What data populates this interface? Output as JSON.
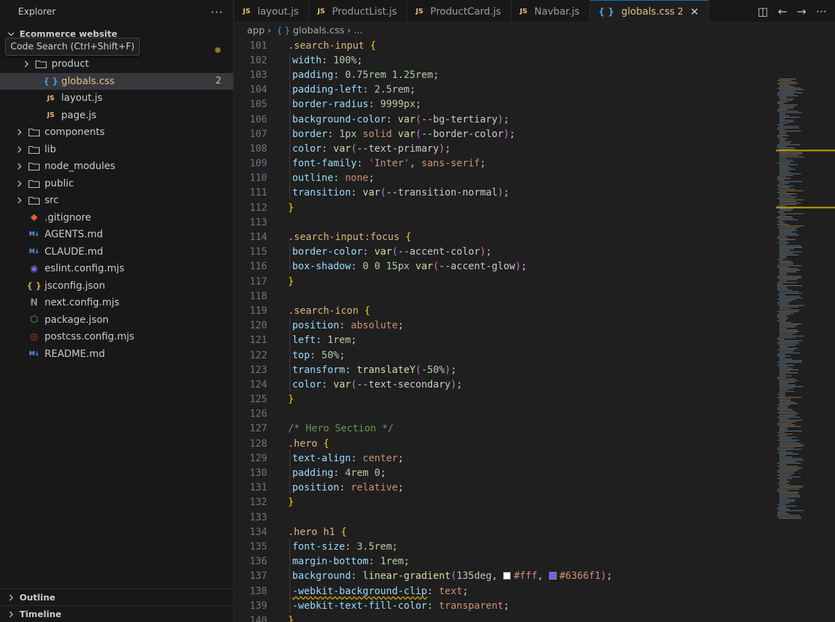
{
  "sidebar": {
    "title": "Explorer",
    "more": "···",
    "root": "Ecommerce website",
    "tooltip": "Code Search (Ctrl+Shift+F)",
    "items": [
      {
        "label": "product",
        "kind": "folder",
        "badge": ""
      },
      {
        "label": "globals.css",
        "kind": "css",
        "badge": "2"
      },
      {
        "label": "layout.js",
        "kind": "js",
        "badge": ""
      },
      {
        "label": "page.js",
        "kind": "js",
        "badge": ""
      },
      {
        "label": "components",
        "kind": "folder",
        "badge": ""
      },
      {
        "label": "lib",
        "kind": "folder",
        "badge": ""
      },
      {
        "label": "node_modules",
        "kind": "folder",
        "badge": ""
      },
      {
        "label": "public",
        "kind": "folder",
        "badge": ""
      },
      {
        "label": "src",
        "kind": "folder",
        "badge": ""
      },
      {
        "label": ".gitignore",
        "kind": "git",
        "badge": ""
      },
      {
        "label": "AGENTS.md",
        "kind": "md",
        "badge": ""
      },
      {
        "label": "CLAUDE.md",
        "kind": "md",
        "badge": ""
      },
      {
        "label": "eslint.config.mjs",
        "kind": "eslint",
        "badge": ""
      },
      {
        "label": "jsconfig.json",
        "kind": "json",
        "badge": ""
      },
      {
        "label": "next.config.mjs",
        "kind": "next",
        "badge": ""
      },
      {
        "label": "package.json",
        "kind": "npm",
        "badge": ""
      },
      {
        "label": "postcss.config.mjs",
        "kind": "postcss",
        "badge": ""
      },
      {
        "label": "README.md",
        "kind": "md",
        "badge": ""
      }
    ],
    "outline": "Outline",
    "timeline": "Timeline"
  },
  "tabs": [
    {
      "label": "layout.js",
      "icon": "JS"
    },
    {
      "label": "ProductList.js",
      "icon": "JS"
    },
    {
      "label": "ProductCard.js",
      "icon": "JS"
    },
    {
      "label": "Navbar.js",
      "icon": "JS"
    },
    {
      "label": "globals.css",
      "icon": "{ }",
      "badge": "2",
      "close": "✕",
      "active": true
    }
  ],
  "breadcrumb": {
    "folder": "app",
    "icon": "{ }",
    "file": "globals.css",
    "more": "..."
  },
  "code": [
    {
      "n": "101",
      "t": [
        [
          "sel",
          ".search-input "
        ],
        [
          "brace",
          "{"
        ]
      ]
    },
    {
      "n": "102",
      "t": [
        [
          "prop",
          "width"
        ],
        [
          "pl",
          ": "
        ],
        [
          "num",
          "100%"
        ],
        [
          "pl",
          ";"
        ]
      ]
    },
    {
      "n": "103",
      "t": [
        [
          "prop",
          "padding"
        ],
        [
          "pl",
          ": "
        ],
        [
          "num",
          "0.75rem 1.25rem"
        ],
        [
          "pl",
          ";"
        ]
      ]
    },
    {
      "n": "104",
      "t": [
        [
          "prop",
          "padding-left"
        ],
        [
          "pl",
          ": "
        ],
        [
          "num",
          "2.5rem"
        ],
        [
          "pl",
          ";"
        ]
      ]
    },
    {
      "n": "105",
      "t": [
        [
          "prop",
          "border-radius"
        ],
        [
          "pl",
          ": "
        ],
        [
          "num",
          "9999px"
        ],
        [
          "pl",
          ";"
        ]
      ]
    },
    {
      "n": "106",
      "t": [
        [
          "prop",
          "background-color"
        ],
        [
          "pl",
          ": "
        ],
        [
          "fn",
          "var"
        ],
        [
          "paren",
          "("
        ],
        [
          "pl",
          "--bg-tertiary"
        ],
        [
          "paren",
          ")"
        ],
        [
          "pl",
          ";"
        ]
      ]
    },
    {
      "n": "107",
      "t": [
        [
          "prop",
          "border"
        ],
        [
          "pl",
          ": "
        ],
        [
          "num",
          "1px"
        ],
        [
          "pl",
          " "
        ],
        [
          "val",
          "solid"
        ],
        [
          "pl",
          " "
        ],
        [
          "fn",
          "var"
        ],
        [
          "paren",
          "("
        ],
        [
          "pl",
          "--border-color"
        ],
        [
          "paren",
          ")"
        ],
        [
          "pl",
          ";"
        ]
      ]
    },
    {
      "n": "108",
      "t": [
        [
          "prop",
          "color"
        ],
        [
          "pl",
          ": "
        ],
        [
          "fn",
          "var"
        ],
        [
          "paren",
          "("
        ],
        [
          "pl",
          "--text-primary"
        ],
        [
          "paren",
          ")"
        ],
        [
          "pl",
          ";"
        ]
      ]
    },
    {
      "n": "109",
      "t": [
        [
          "prop",
          "font-family"
        ],
        [
          "pl",
          ": "
        ],
        [
          "val",
          "'Inter'"
        ],
        [
          "pl",
          ", "
        ],
        [
          "val",
          "sans-serif"
        ],
        [
          "pl",
          ";"
        ]
      ]
    },
    {
      "n": "110",
      "t": [
        [
          "prop",
          "outline"
        ],
        [
          "pl",
          ": "
        ],
        [
          "val",
          "none"
        ],
        [
          "pl",
          ";"
        ]
      ]
    },
    {
      "n": "111",
      "t": [
        [
          "prop",
          "transition"
        ],
        [
          "pl",
          ": "
        ],
        [
          "fn",
          "var"
        ],
        [
          "paren",
          "("
        ],
        [
          "pl",
          "--transition-normal"
        ],
        [
          "paren",
          ")"
        ],
        [
          "pl",
          ";"
        ]
      ]
    },
    {
      "n": "112",
      "t": [
        [
          "brace",
          "}"
        ]
      ]
    },
    {
      "n": "113",
      "t": []
    },
    {
      "n": "114",
      "t": [
        [
          "sel",
          ".search-input:focus "
        ],
        [
          "brace",
          "{"
        ]
      ]
    },
    {
      "n": "115",
      "t": [
        [
          "prop",
          "border-color"
        ],
        [
          "pl",
          ": "
        ],
        [
          "fn",
          "var"
        ],
        [
          "paren",
          "("
        ],
        [
          "pl",
          "--accent-color"
        ],
        [
          "paren",
          ")"
        ],
        [
          "pl",
          ";"
        ]
      ]
    },
    {
      "n": "116",
      "t": [
        [
          "prop",
          "box-shadow"
        ],
        [
          "pl",
          ": "
        ],
        [
          "num",
          "0 0 15px"
        ],
        [
          "pl",
          " "
        ],
        [
          "fn",
          "var"
        ],
        [
          "paren",
          "("
        ],
        [
          "pl",
          "--accent-glow"
        ],
        [
          "paren",
          ")"
        ],
        [
          "pl",
          ";"
        ]
      ]
    },
    {
      "n": "117",
      "t": [
        [
          "brace",
          "}"
        ]
      ]
    },
    {
      "n": "118",
      "t": []
    },
    {
      "n": "119",
      "t": [
        [
          "sel",
          ".search-icon "
        ],
        [
          "brace",
          "{"
        ]
      ]
    },
    {
      "n": "120",
      "t": [
        [
          "prop",
          "position"
        ],
        [
          "pl",
          ": "
        ],
        [
          "val",
          "absolute"
        ],
        [
          "pl",
          ";"
        ]
      ]
    },
    {
      "n": "121",
      "t": [
        [
          "prop",
          "left"
        ],
        [
          "pl",
          ": "
        ],
        [
          "num",
          "1rem"
        ],
        [
          "pl",
          ";"
        ]
      ]
    },
    {
      "n": "122",
      "t": [
        [
          "prop",
          "top"
        ],
        [
          "pl",
          ": "
        ],
        [
          "num",
          "50%"
        ],
        [
          "pl",
          ";"
        ]
      ]
    },
    {
      "n": "123",
      "t": [
        [
          "prop",
          "transform"
        ],
        [
          "pl",
          ": "
        ],
        [
          "fn",
          "translateY"
        ],
        [
          "paren",
          "("
        ],
        [
          "num",
          "-50%"
        ],
        [
          "paren",
          ")"
        ],
        [
          "pl",
          ";"
        ]
      ]
    },
    {
      "n": "124",
      "t": [
        [
          "prop",
          "color"
        ],
        [
          "pl",
          ": "
        ],
        [
          "fn",
          "var"
        ],
        [
          "paren",
          "("
        ],
        [
          "pl",
          "--text-secondary"
        ],
        [
          "paren",
          ")"
        ],
        [
          "pl",
          ";"
        ]
      ]
    },
    {
      "n": "125",
      "t": [
        [
          "brace",
          "}"
        ]
      ]
    },
    {
      "n": "126",
      "t": []
    },
    {
      "n": "127",
      "t": [
        [
          "cmt",
          "/* Hero Section */"
        ]
      ]
    },
    {
      "n": "128",
      "t": [
        [
          "sel",
          ".hero "
        ],
        [
          "brace",
          "{"
        ]
      ]
    },
    {
      "n": "129",
      "t": [
        [
          "prop",
          "text-align"
        ],
        [
          "pl",
          ": "
        ],
        [
          "val",
          "center"
        ],
        [
          "pl",
          ";"
        ]
      ]
    },
    {
      "n": "130",
      "t": [
        [
          "prop",
          "padding"
        ],
        [
          "pl",
          ": "
        ],
        [
          "num",
          "4rem 0"
        ],
        [
          "pl",
          ";"
        ]
      ]
    },
    {
      "n": "131",
      "t": [
        [
          "prop",
          "position"
        ],
        [
          "pl",
          ": "
        ],
        [
          "val",
          "relative"
        ],
        [
          "pl",
          ";"
        ]
      ]
    },
    {
      "n": "132",
      "t": [
        [
          "brace",
          "}"
        ]
      ]
    },
    {
      "n": "133",
      "t": []
    },
    {
      "n": "134",
      "t": [
        [
          "sel",
          ".hero h1 "
        ],
        [
          "brace",
          "{"
        ]
      ]
    },
    {
      "n": "135",
      "t": [
        [
          "prop",
          "font-size"
        ],
        [
          "pl",
          ": "
        ],
        [
          "num",
          "3.5rem"
        ],
        [
          "pl",
          ";"
        ]
      ]
    },
    {
      "n": "136",
      "t": [
        [
          "prop",
          "margin-bottom"
        ],
        [
          "pl",
          ": "
        ],
        [
          "num",
          "1rem"
        ],
        [
          "pl",
          ";"
        ]
      ]
    },
    {
      "n": "137",
      "t": [
        [
          "prop",
          "background"
        ],
        [
          "pl",
          ": "
        ],
        [
          "fn",
          "linear-gradient"
        ],
        [
          "paren",
          "("
        ],
        [
          "num",
          "135deg"
        ],
        [
          "pl",
          ", "
        ],
        [
          "sw1",
          ""
        ],
        [
          "val",
          "#fff"
        ],
        [
          "pl",
          ", "
        ],
        [
          "sw2",
          ""
        ],
        [
          "val",
          "#6366f1"
        ],
        [
          "paren",
          ")"
        ],
        [
          "pl",
          ";"
        ]
      ]
    },
    {
      "n": "138",
      "t": [
        [
          "propsq",
          "-webkit-background-clip"
        ],
        [
          "pl",
          ": "
        ],
        [
          "val",
          "text"
        ],
        [
          "pl",
          ";"
        ]
      ]
    },
    {
      "n": "139",
      "t": [
        [
          "prop",
          "-webkit-text-fill-color"
        ],
        [
          "pl",
          ": "
        ],
        [
          "val",
          "transparent"
        ],
        [
          "pl",
          ";"
        ]
      ]
    },
    {
      "n": "140",
      "t": [
        [
          "brace",
          "}"
        ]
      ]
    }
  ],
  "colors": {
    "swatch1": "#ffffff",
    "swatch2": "#6366f1",
    "accent": "#0078d4"
  }
}
